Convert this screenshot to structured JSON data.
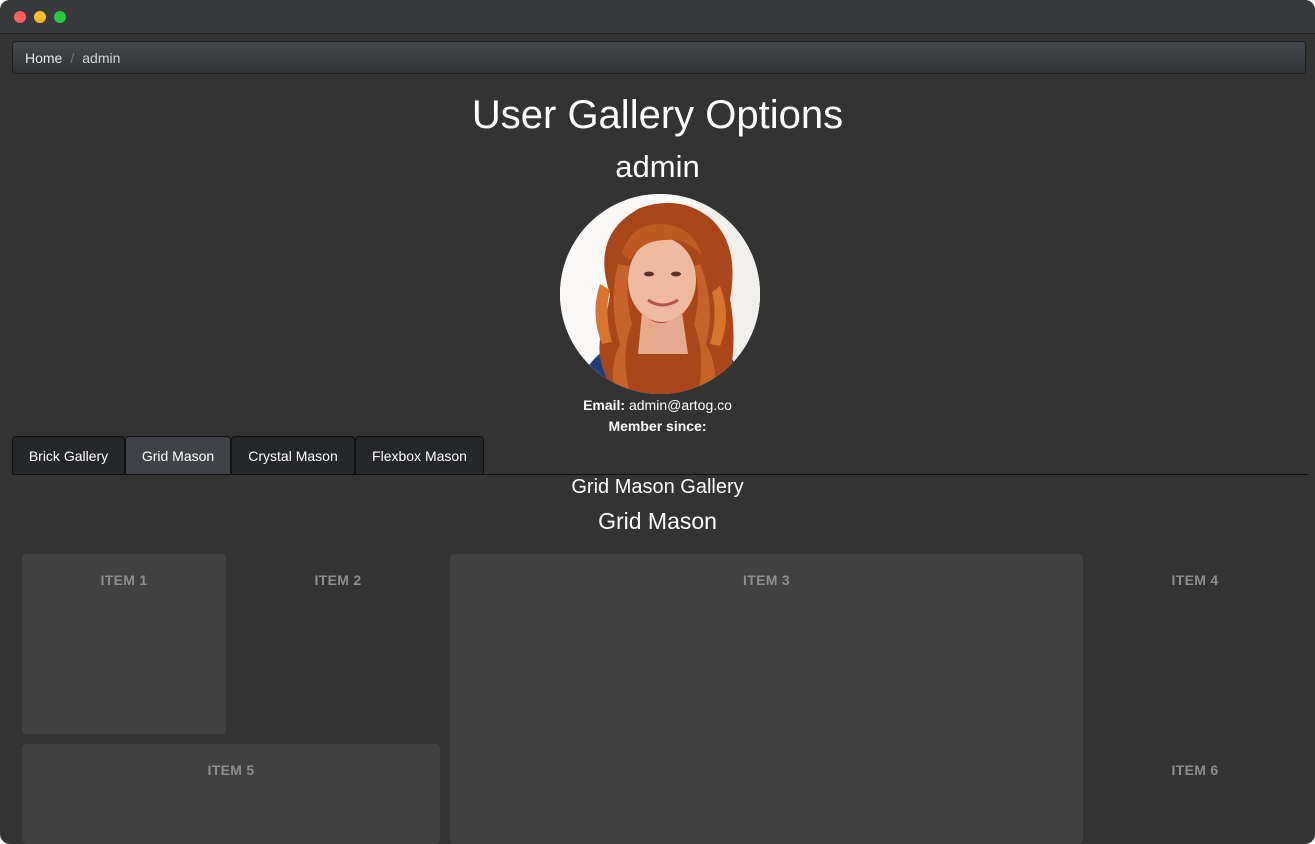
{
  "breadcrumb": {
    "home": "Home",
    "separator": "/",
    "current": "admin"
  },
  "page": {
    "title": "User Gallery Options",
    "user_name": "admin"
  },
  "profile": {
    "email_label": "Email:",
    "email_value": "admin@artog.co",
    "member_since_label": "Member since:",
    "member_since_value": ""
  },
  "tabs": [
    {
      "label": "Brick Gallery",
      "active": false
    },
    {
      "label": "Grid Mason",
      "active": true
    },
    {
      "label": "Crystal Mason",
      "active": false
    },
    {
      "label": "Flexbox Mason",
      "active": false
    }
  ],
  "gallery": {
    "heading": "Grid Mason Gallery",
    "subheading": "Grid Mason",
    "items": [
      "ITEM 1",
      "ITEM 2",
      "ITEM 3",
      "ITEM 4",
      "ITEM 5",
      "ITEM 6"
    ]
  },
  "colors": {
    "background": "#333333",
    "tile": "#414141",
    "active_tab": "#3f4246",
    "tab": "#25272a",
    "item_label": "#8d8d8d"
  }
}
